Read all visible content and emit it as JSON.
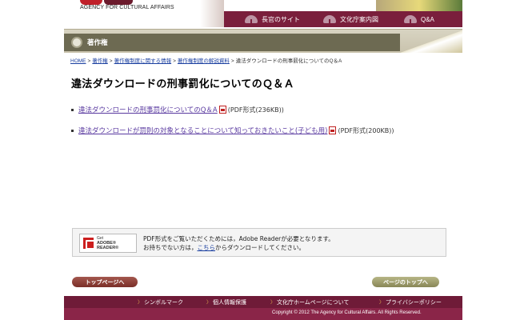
{
  "header": {
    "logo_text": "AGENCY FOR CULTURAL AFFAIRS",
    "nav": [
      {
        "label": "長官のサイト",
        "icon": "fan-icon"
      },
      {
        "label": "文化庁案内図",
        "icon": "fan-icon"
      },
      {
        "label": "Q&A",
        "icon": "fan-icon"
      }
    ]
  },
  "section": {
    "title": "著作権",
    "icon": "disc-icon"
  },
  "breadcrumb": [
    "HOME",
    "著作権",
    "著作権制度に関する情報",
    "著作権制度の解説資料",
    "違法ダウンロードの刑事罰化についてのQ＆A"
  ],
  "page_title": "違法ダウンロードの刑事罰化についてのＱ＆Ａ",
  "documents": [
    {
      "link": "違法ダウンロードの刑事罰化についてのQ＆A",
      "meta": "(PDF形式(236KB))"
    },
    {
      "link": "違法ダウンロードが罰則の対象となることについて知っておきたいこと(子ども用)",
      "meta": "(PDF形式(200KB))"
    }
  ],
  "adobe": {
    "button_get": "Get",
    "button_brand": "ADOBE® READER®",
    "line1": "PDF形式をご覧いただくためには，Adobe Readerが必要となります。",
    "line2_before": "お持ちでない方は，",
    "line2_link": "こちら",
    "line2_after": "からダウンロードしてください。"
  },
  "buttons": {
    "back_home": "トップページへ",
    "page_top": "ページのトップへ"
  },
  "footer": {
    "links": [
      "シンボルマーク",
      "個人情報保護",
      "文化庁ホームページについて",
      "プライバシーポリシー"
    ],
    "copyright": "Copyright © 2012 The Agency for Cultural Affairs. All Rights Reserved."
  },
  "colors": {
    "brand_maroon": "#7a1f3c",
    "section_olive": "#6d6a52",
    "link_blue": "#1a3fa0",
    "visited_purple": "#5a3aa0"
  }
}
